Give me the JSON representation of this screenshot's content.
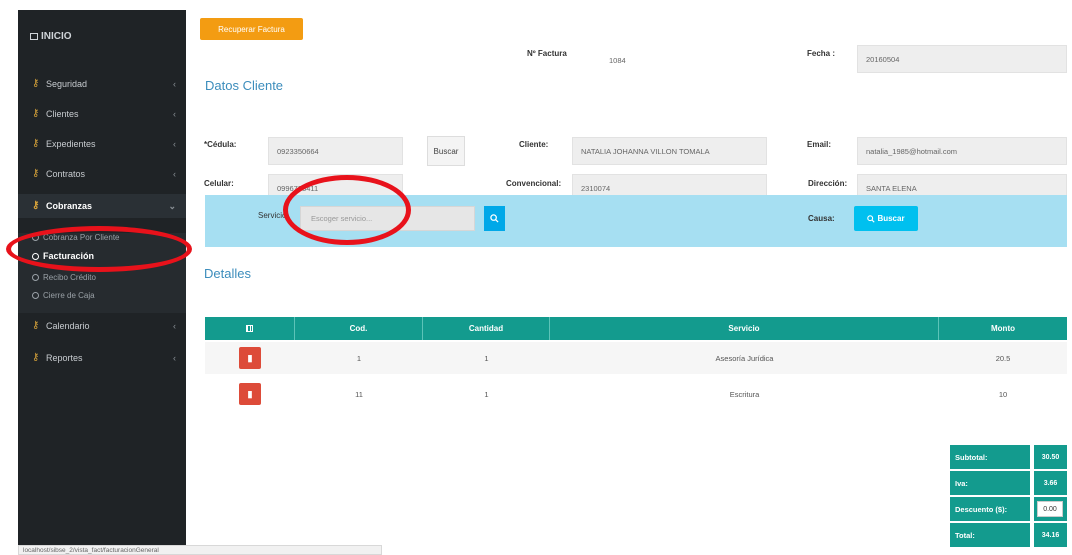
{
  "sidebar": {
    "header": "INICIO",
    "items": [
      {
        "label": "Seguridad"
      },
      {
        "label": "Clientes"
      },
      {
        "label": "Expedientes"
      },
      {
        "label": "Contratos"
      },
      {
        "label": "Cobranzas"
      },
      {
        "label": "Calendario"
      },
      {
        "label": "Reportes"
      }
    ],
    "subitems": [
      {
        "label": "Cobranza Por Cliente"
      },
      {
        "label": "Facturación"
      },
      {
        "label": "Recibo Crédito"
      },
      {
        "label": "Cierre de Caja"
      }
    ]
  },
  "toolbar": {
    "recuperar_label": "Recuperar Factura"
  },
  "factura": {
    "numero_label": "Nº Factura",
    "numero_value": "1084",
    "fecha_label": "Fecha :",
    "fecha_value": "20160504"
  },
  "cliente": {
    "section_title": "Datos Cliente",
    "cedula_label": "*Cédula:",
    "cedula_value": "0923350664",
    "buscar_label": "Buscar",
    "cliente_label": "Cliente:",
    "cliente_value": "NATALIA JOHANNA VILLON TOMALA",
    "email_label": "Email:",
    "email_value": "natalia_1985@hotmail.com",
    "celular_label": "Celular:",
    "celular_value": "0996733411",
    "convencional_label": "Convencional:",
    "convencional_value": "2310074",
    "direccion_label": "Dirección:",
    "direccion_value": "SANTA ELENA"
  },
  "filtro": {
    "servicio_label": "Servicio:",
    "servicio_placeholder": "Escoger servicio...",
    "causa_label": "Causa:",
    "buscar_label": "Buscar"
  },
  "detalles": {
    "section_title": "Detalles",
    "columns": [
      "Cod.",
      "Cantidad",
      "Servicio",
      "Monto"
    ],
    "rows": [
      {
        "cod": "1",
        "cantidad": "1",
        "servicio": "Asesoría Jurídica",
        "monto": "20.5"
      },
      {
        "cod": "11",
        "cantidad": "1",
        "servicio": "Escritura",
        "monto": "10"
      }
    ]
  },
  "totales": {
    "subtotal_label": "Subtotal:",
    "subtotal_value": "30.50",
    "iva_label": "Iva:",
    "iva_value": "3.66",
    "descuento_label": "Descuento ($):",
    "descuento_value": "0.00",
    "total_label": "Total:",
    "total_value": "34.16"
  },
  "statusbar": {
    "text": "localhost/sibse_2/vista_fact/facturacionGeneral"
  },
  "colors": {
    "sidebar": "#1f2326",
    "accent_orange": "#f39c12",
    "teal": "#139b8e",
    "filter_bg": "#a6dff2",
    "annotation_red": "#e8121b",
    "delete_red": "#dd4b39"
  }
}
